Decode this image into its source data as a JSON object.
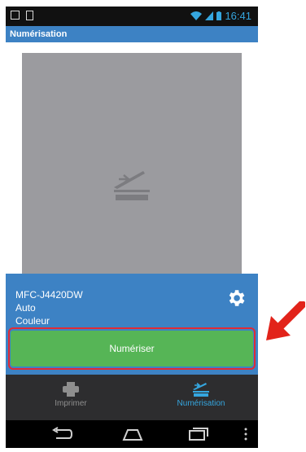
{
  "status_bar": {
    "time": "16:41"
  },
  "action_bar": {
    "title": "Numérisation"
  },
  "info": {
    "device": "MFC-J4420DW",
    "size": "Auto",
    "color": "Couleur"
  },
  "scan_button": {
    "label": "Numériser",
    "color": "#56b556",
    "highlight_color": "#e02b36"
  },
  "tabs": [
    {
      "label": "Imprimer",
      "icon": "printer-icon",
      "active": false
    },
    {
      "label": "Numérisation",
      "icon": "scanner-icon",
      "active": true
    }
  ],
  "nav_bar": {
    "icons": [
      "back-icon",
      "home-icon",
      "recents-icon",
      "menu-icon"
    ]
  },
  "colors": {
    "accent": "#3d82c4",
    "time": "#35a6df",
    "active_tab": "#35a6df",
    "inactive_tab": "#8e8e8e"
  }
}
